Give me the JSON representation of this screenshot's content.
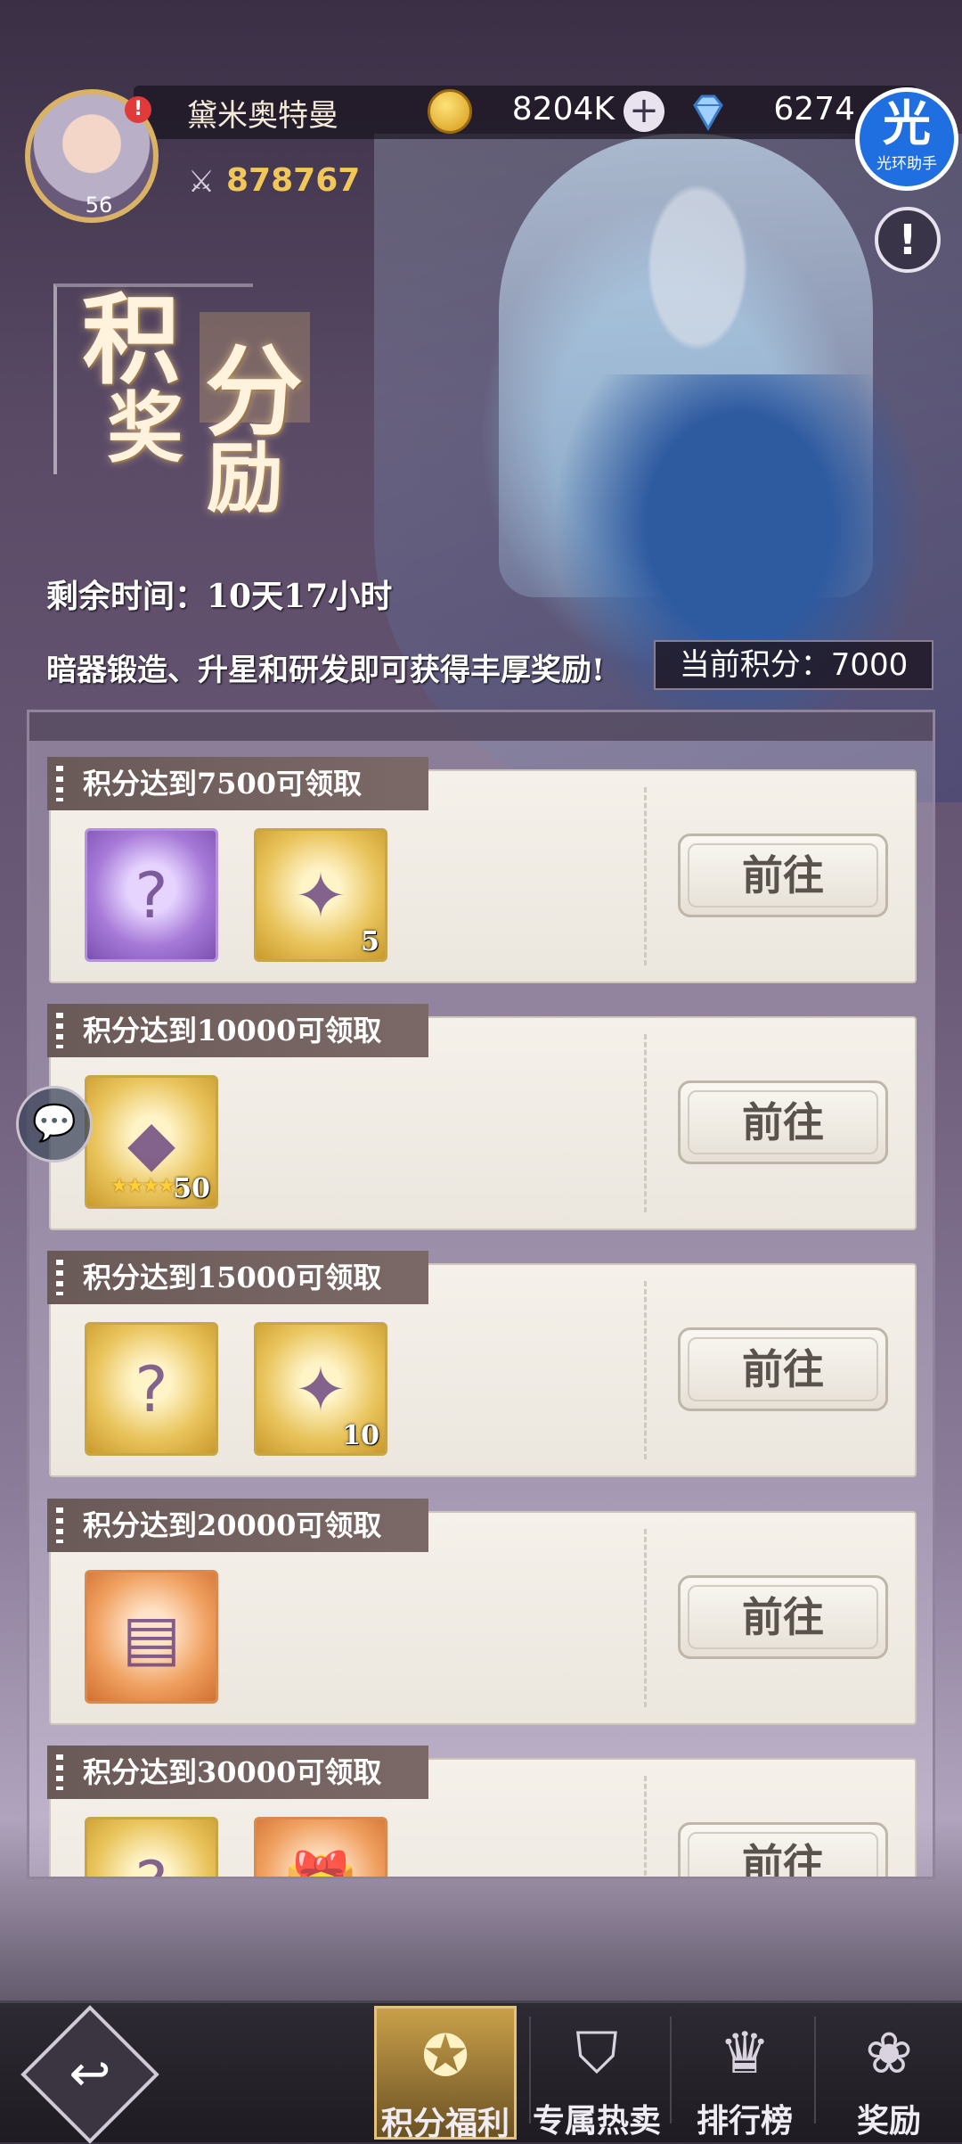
{
  "header": {
    "username": "黛米奥特曼",
    "coins": "8204K",
    "plus_label": "+",
    "gems": "6274",
    "halo_assistant": {
      "big": "光",
      "small": "光环助手"
    },
    "avatar_level": "56",
    "avatar_alert": "!",
    "power": "878767",
    "info_label": "!"
  },
  "title": {
    "chars": [
      "积",
      "分",
      "奖",
      "励"
    ]
  },
  "event": {
    "remaining_time": "剩余时间：10天17小时",
    "description": "暗器锻造、升星和研发即可获得丰厚奖励!",
    "current_points": "当前积分：7000"
  },
  "rewards": [
    {
      "title": "积分达到7500可领取",
      "button": "前往",
      "items": [
        {
          "icon": "lucky-bag-icon",
          "qty": ""
        },
        {
          "icon": "card-icon",
          "qty": "5"
        }
      ]
    },
    {
      "title": "积分达到10000可领取",
      "button": "前往",
      "items": [
        {
          "icon": "crystal-icon",
          "qty": "50",
          "stars": "★★★★★"
        }
      ]
    },
    {
      "title": "积分达到15000可领取",
      "button": "前往",
      "items": [
        {
          "icon": "lucky-bag-icon",
          "qty": ""
        },
        {
          "icon": "card-icon",
          "qty": "10"
        }
      ]
    },
    {
      "title": "积分达到20000可领取",
      "button": "前往",
      "items": [
        {
          "icon": "card-pack-icon",
          "qty": ""
        }
      ]
    },
    {
      "title": "积分达到30000可领取",
      "button": "前往",
      "items": [
        {
          "icon": "lucky-bag-icon",
          "qty": ""
        },
        {
          "icon": "gift-icon",
          "qty": ""
        }
      ]
    }
  ],
  "nav": {
    "back": "↩",
    "tabs": [
      "积分福利",
      "专属热卖",
      "排行榜",
      "奖励"
    ]
  },
  "colors": {
    "gold": "#c9a04a",
    "card_bg": "#f5f1ea",
    "tag_bg": "#6a5a57"
  }
}
